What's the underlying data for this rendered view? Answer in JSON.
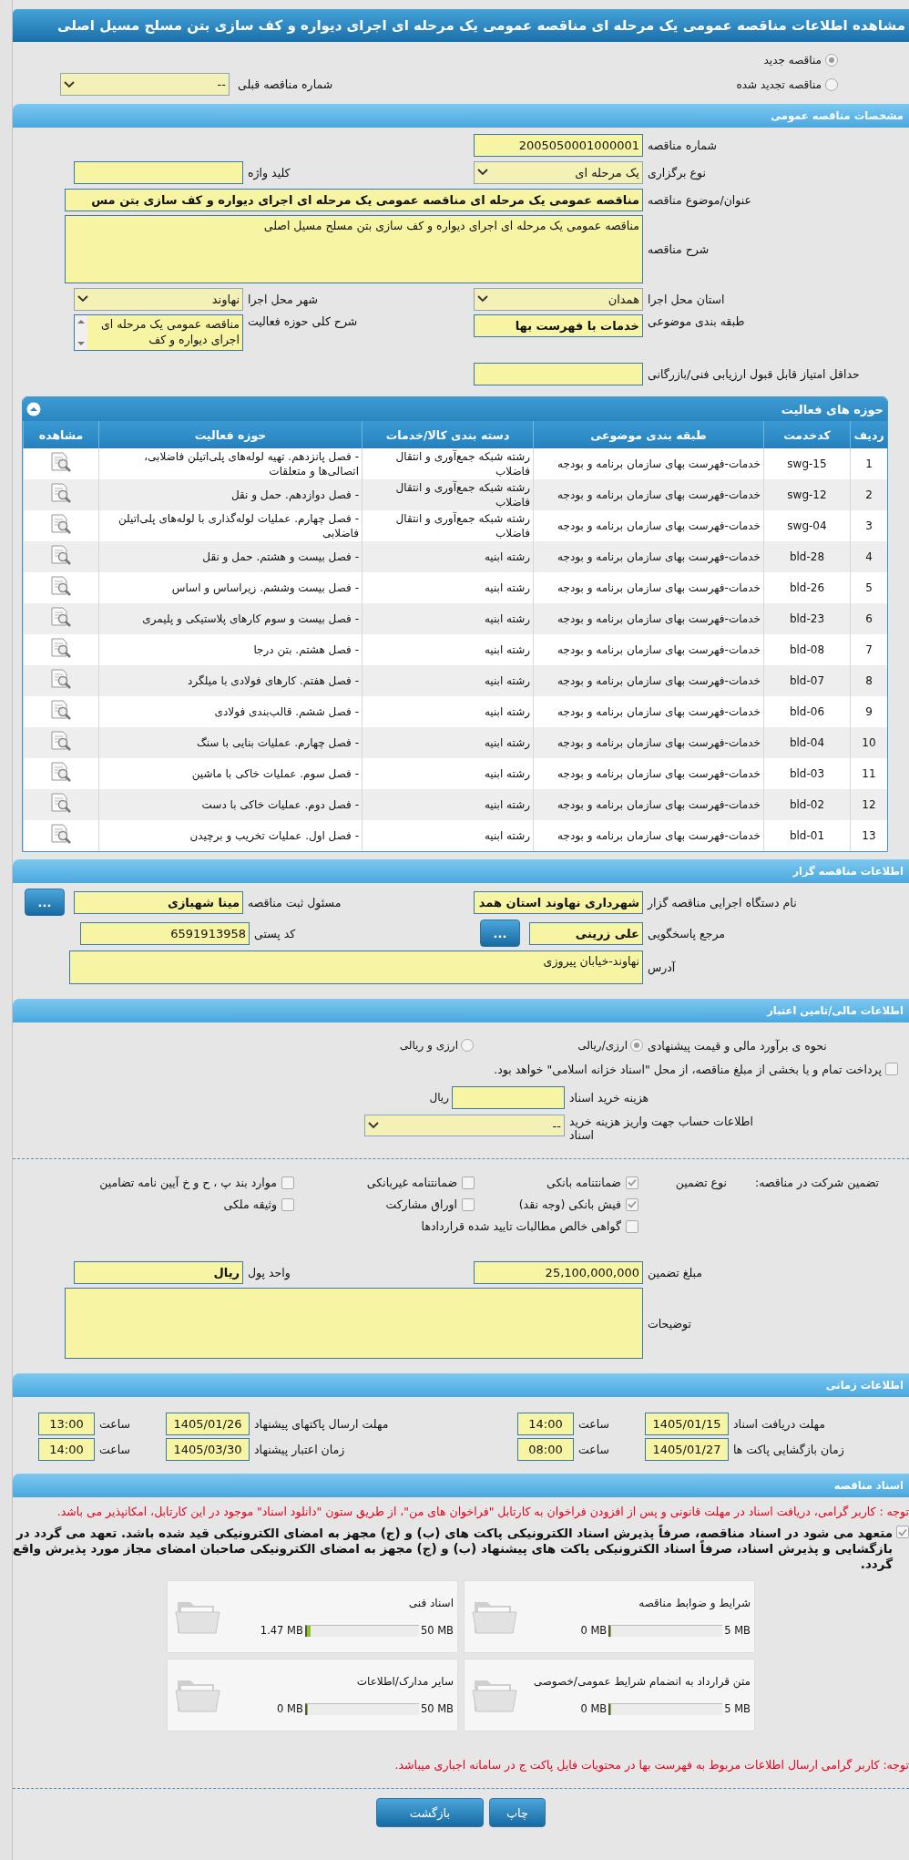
{
  "window": {
    "title": "مشاهده اطلاعات مناقصه عمومی یک مرحله ای مناقصه عمومی یک مرحله ای اجرای دیواره و کف سازی بتن مسلح مسیل اصلی"
  },
  "tender_type": {
    "options": [
      {
        "label": "مناقصه جدید",
        "selected": true
      },
      {
        "label": "مناقصه تجدید شده",
        "selected": false
      }
    ],
    "previous_tender": {
      "label": "شماره مناقصه قبلی",
      "value": "--"
    }
  },
  "general": {
    "title": "مشخصات مناقصه عمومی",
    "rows": [
      [
        {
          "label": "شماره مناقصه",
          "kind": "input",
          "value": "2005050001000001"
        }
      ],
      [
        {
          "label": "نوع برگزاری",
          "kind": "select",
          "value": "یک مرحله ای"
        },
        {
          "label": "کلید واژه",
          "kind": "input"
        }
      ],
      [
        {
          "label": "عنوان/موضوع مناقصه",
          "kind": "wide-input",
          "value": "مناقصه عمومی یک مرحله ای مناقصه عمومی یک مرحله ای اجرای دیواره و کف سازی بتن مس",
          "bold": true
        }
      ],
      [
        {
          "label": "شرح مناقصه",
          "kind": "textarea",
          "value": "مناقصه عمومی یک مرحله ای اجرای دیواره و کف سازی بتن مسلح مسیل اصلی"
        }
      ],
      [
        {
          "label": "استان محل اجرا",
          "kind": "select",
          "value": "همدان"
        },
        {
          "label": "شهر محل اجرا",
          "kind": "select",
          "value": "نهاوند"
        }
      ],
      [
        {
          "label": "طبقه بندی موضوعی",
          "kind": "input",
          "value": "خدمات با فهرست بها",
          "bold": true
        },
        {
          "label": "شرح کلی حوزه فعالیت",
          "kind": "listbox",
          "value": "مناقصه عمومی یک مرحله ای اجرای دیواره و کف"
        }
      ],
      [
        {
          "label": "حداقل امتیاز قابل قبول ارزیابی فنی/بازرگانی",
          "kind": "input"
        }
      ]
    ]
  },
  "activities": {
    "title": "حوزه های فعالیت",
    "columns": [
      "ردیف",
      "کدخدمت",
      "طبقه بندی موضوعی",
      "دسته بندی کالا/خدمات",
      "حوزه فعالیت",
      "مشاهده"
    ],
    "rows": [
      [
        "1",
        "swg-15",
        "خدمات-فهرست بهای سازمان برنامه و بودجه",
        "رشته شبکه جمع‌آوری و انتقال فاضلاب",
        "- فصل پانزدهم. تهیه لوله‌های پلی‌اتیلن فاضلابی، اتصالی‌ها و متعلقات"
      ],
      [
        "2",
        "swg-12",
        "خدمات-فهرست بهای سازمان برنامه و بودجه",
        "رشته شبکه جمع‌آوری و انتقال فاضلاب",
        "- فصل دوازدهم. حمل و نقل"
      ],
      [
        "3",
        "swg-04",
        "خدمات-فهرست بهای سازمان برنامه و بودجه",
        "رشته شبکه جمع‌آوری و انتقال فاضلاب",
        "- فصل چهارم. عملیات لوله‌گذاری با لوله‌های پلی‌اتیلن فاضلابی"
      ],
      [
        "4",
        "bld-28",
        "خدمات-فهرست بهای سازمان برنامه و بودجه",
        "رشته ابنیه",
        "- فصل بیست و هشتم. حمل و نقل"
      ],
      [
        "5",
        "bld-26",
        "خدمات-فهرست بهای سازمان برنامه و بودجه",
        "رشته ابنیه",
        "- فصل بیست وششم. زیراساس و اساس"
      ],
      [
        "6",
        "bld-23",
        "خدمات-فهرست بهای سازمان برنامه و بودجه",
        "رشته ابنیه",
        "- فصل بیست و سوم کارهای پلاستیکی و پلیمری"
      ],
      [
        "7",
        "bld-08",
        "خدمات-فهرست بهای سازمان برنامه و بودجه",
        "رشته ابنیه",
        "- فصل هشتم. بتن درجا"
      ],
      [
        "8",
        "bld-07",
        "خدمات-فهرست بهای سازمان برنامه و بودجه",
        "رشته ابنیه",
        "- فصل هفتم. کارهای فولادی با میلگرد"
      ],
      [
        "9",
        "bld-06",
        "خدمات-فهرست بهای سازمان برنامه و بودجه",
        "رشته ابنیه",
        "- فصل ششم. قالب‌بندی فولادی"
      ],
      [
        "10",
        "bld-04",
        "خدمات-فهرست بهای سازمان برنامه و بودجه",
        "رشته ابنیه",
        "- فصل چهارم. عملیات بنایی با سنگ"
      ],
      [
        "11",
        "bld-03",
        "خدمات-فهرست بهای سازمان برنامه و بودجه",
        "رشته ابنیه",
        "- فصل سوم. عملیات خاکی با ماشین"
      ],
      [
        "12",
        "bld-02",
        "خدمات-فهرست بهای سازمان برنامه و بودجه",
        "رشته ابنیه",
        "- فصل دوم. عملیات خاکی با دست"
      ],
      [
        "13",
        "bld-01",
        "خدمات-فهرست بهای سازمان برنامه و بودجه",
        "رشته ابنیه",
        "- فصل اول. عملیات تخریب و برچیدن"
      ]
    ]
  },
  "tenderer": {
    "title": "اطلاعات مناقصه گزار",
    "rows": [
      [
        {
          "label": "نام دستگاه اجرایی مناقصه گزار",
          "kind": "input",
          "value": "شهرداری نهاوند استان همد",
          "bold": true
        },
        {
          "label": "مسئول ثبت مناقصه",
          "kind": "input",
          "value": "مینا شهبازی",
          "bold": true,
          "button": "..."
        }
      ],
      [
        {
          "label": "مرجع پاسخگویی",
          "kind": "short-input",
          "value": "علی زرینی",
          "bold": true,
          "button": "..."
        },
        {
          "label": "کد پستی",
          "kind": "input",
          "value": "6591913958"
        }
      ],
      [
        {
          "label": "آدرس",
          "kind": "address",
          "value": "نهاوند-خیابان پیروزی"
        }
      ]
    ]
  },
  "finance": {
    "title": "اطلاعات مالی/تامین اعتبار",
    "estimate": {
      "label": "نحوه ی برآورد مالی و قیمت پیشنهادی",
      "options": [
        {
          "label": "ارزی/ریالی",
          "selected": true
        },
        {
          "label": "ارزی و ریالی",
          "selected": false
        }
      ]
    },
    "treasury": {
      "label": "پرداخت تمام و یا بخشی از مبلغ مناقصه، از محل \"اسناد خزانه اسلامی\" خواهد بود.",
      "checked": false
    },
    "doc_fee": {
      "label": "هزینه خرید اسناد",
      "unit": "ریال"
    },
    "account": {
      "label": "اطلاعات حساب جهت واریز هزینه خرید اسناد",
      "value": "--"
    }
  },
  "guarantee": {
    "label": "تضمین شرکت در مناقصه:",
    "type_label": "نوع تضمین",
    "options": [
      {
        "label": "ضمانتنامه بانکی",
        "checked": true
      },
      {
        "label": "ضمانتنامه غیربانکی",
        "checked": false
      },
      {
        "label": "موارد بند پ ، ح و خ آیین نامه تضامین",
        "checked": false
      },
      {
        "label": "فیش بانکی (وجه نقد)",
        "checked": true
      },
      {
        "label": "اوراق مشارکت",
        "checked": false
      },
      {
        "label": "وثیقه ملکی",
        "checked": false
      },
      {
        "label": "گواهی خالص مطالبات تایید شده قراردادها",
        "checked": false
      }
    ],
    "rows": [
      [
        {
          "label": "مبلغ تضمین",
          "kind": "input",
          "value": "25,100,000,000"
        },
        {
          "label": "واحد پول",
          "kind": "input",
          "value": "ریال",
          "bold": true
        }
      ],
      [
        {
          "label": "توضیحات",
          "kind": "notes"
        }
      ]
    ]
  },
  "timing": {
    "title": "اطلاعات زمانی",
    "rows": [
      [
        {
          "label": "مهلت دریافت اسناد",
          "date": "1405/01/15",
          "time_label": "ساعت",
          "time": "14:00"
        },
        {
          "label": "مهلت ارسال پاکتهای پیشنهاد",
          "date": "1405/01/26",
          "time_label": "ساعت",
          "time": "13:00"
        }
      ],
      [
        {
          "label": "زمان بازگشایی پاکت ها",
          "date": "1405/01/27",
          "time_label": "ساعت",
          "time": "08:00"
        },
        {
          "label": "زمان اعتبار پیشنهاد",
          "date": "1405/03/30",
          "time_label": "ساعت",
          "time": "14:00"
        }
      ]
    ]
  },
  "documents": {
    "title": "اسناد مناقصه",
    "notice": "توجه : کاربر گرامی، دریافت اسناد در مهلت قانونی و پس از افزودن فراخوان به کارتابل \"فراخوان های من\"، از طریق ستون \"دانلود اسناد\" موجود در این کارتابل، امکانپذیر می باشد.",
    "commitment": {
      "checked": true,
      "text": "متعهد می شود در اسناد مناقصه، صرفاً پذیرش اسناد الکترونیکی پاکت های (ب) و (ج) مجهز به امضای الکترونیکی قید شده باشد. تعهد می گردد در بازگشایی و پذیرش اسناد، صرفاً اسناد الکترونیکی پاکت های پیشنهاد (ب) و (ج) مجهز به امضای الکترونیکی صاحبان امضای مجاز مورد پذیرش واقع گردد."
    },
    "files": [
      {
        "title": "شرایط و ضوابط مناقصه",
        "max": "5 MB",
        "used": "0 MB",
        "level": 0
      },
      {
        "title": "اسناد فنی",
        "max": "50 MB",
        "used": "1.47 MB",
        "level": 0.03
      },
      {
        "title": "متن قرارداد به انضمام شرایط عمومی/خصوصی",
        "max": "5 MB",
        "used": "0 MB",
        "level": 0
      },
      {
        "title": "سایر مدارک/اطلاعات",
        "max": "50 MB",
        "used": "0 MB",
        "level": 0
      }
    ],
    "footer_notice": "توجه: کاربر گرامی ارسال اطلاعات مربوط به فهرست بها در محتویات فایل پاکت ج در سامانه اجباری میباشد."
  },
  "buttons": [
    {
      "label": "چاپ"
    },
    {
      "label": "بازگشت"
    }
  ]
}
